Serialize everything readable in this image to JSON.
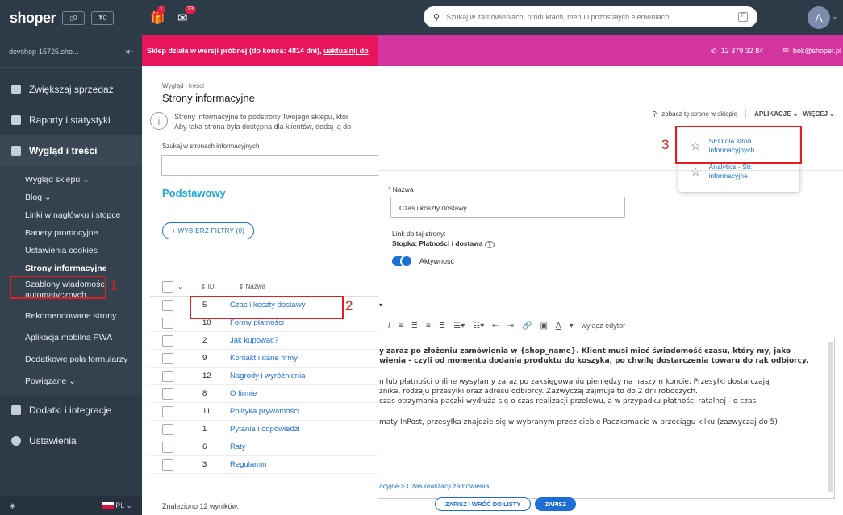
{
  "sidebar": {
    "logo": "shoper",
    "mini_a": "0",
    "mini_b": "0",
    "shop_name": "devshop-15725.sho...",
    "main_items": [
      "Zwiększaj sprzedaż",
      "Raporty i statystyki",
      "Wygląd i treści"
    ],
    "sub_items": [
      "Wygląd sklepu",
      "Blog",
      "Linki w nagłówku i stopce",
      "Banery promocyjne",
      "Ustawienia cookies",
      "Strony informacyjne",
      "Szablony wiadomości automatycznych",
      "Rekomendowane strony",
      "Aplikacja mobilna PWA",
      "Dodatkowe pola formularzy",
      "Powiązane"
    ],
    "extra_items": [
      "Dodatki i integracje",
      "Ustawienia"
    ],
    "lang": "PL"
  },
  "top": {
    "gift_badge": "1",
    "mail_badge": "23",
    "search_placeholder": "Szukaj w zamówieniach, produktach, menu i pozostałych elementach",
    "avatar_letter": "A"
  },
  "banner": {
    "text": "Sklep działa w wersji próbnej (do końca: 4814 dni),",
    "link": "uaktualnij do"
  },
  "contact": {
    "phone": "12 379 32 84",
    "email": "bok@shoper.pl"
  },
  "list_page": {
    "crumb": "Wygląd i treści",
    "title": "Strony informacyjne",
    "info_line1": "Strony informacyjne to podstrony Twojego sklepu, któr",
    "info_line2": "Aby taka strona była dostępna dla klientów, dodaj ją do",
    "search_label": "Szukaj w stronach informacyjnych",
    "section": "Podstawowy",
    "filter_button": "+ WYBIERZ FILTRY (0)",
    "col_id": "ID",
    "col_name": "Nazwa",
    "rows": [
      {
        "id": "5",
        "name": "Czas i koszty dostawy"
      },
      {
        "id": "10",
        "name": "Formy płatności"
      },
      {
        "id": "2",
        "name": "Jak kupować?"
      },
      {
        "id": "9",
        "name": "Kontakt i dane firmy"
      },
      {
        "id": "12",
        "name": "Nagrody i wyróżnienia"
      },
      {
        "id": "8",
        "name": "O firmie"
      },
      {
        "id": "11",
        "name": "Polityka prywatności"
      },
      {
        "id": "1",
        "name": "Pytania i odpowiedzi"
      },
      {
        "id": "6",
        "name": "Raty"
      },
      {
        "id": "3",
        "name": "Regulamin"
      }
    ],
    "found": "Znaleziono 12 wyników."
  },
  "edit_page": {
    "view_link": "zobacz tę stronę w sklepie",
    "apps": "APLIKACJE",
    "more": "WIĘCEJ",
    "dropdown": [
      "SEO dla stron informacyjnych",
      "Analytics - Str. informacyjne"
    ],
    "name_label": "Nazwa",
    "name_value": "Czas i koszty dostawy",
    "link_label": "Link do tej strony:",
    "link_value": "Stopka: Płatności i dostawa",
    "active_label": "Aktywność",
    "disable_editor": "wyłącz edytor",
    "editor_lines": [
      "y zaraz po złożeniu zamówienia w {shop_name}. Klient musi mieć świadomość czasu, który my, jako",
      "wienia - czyli od momentu dodania produktu do koszyka, po chwilę dostarczenia towaru do rąk odbiorcy.",
      "n lub płatności online wysyłamy zaraz po zaksięgowaniu pieniędzy na naszym koncie. Przesyłki dostarczają",
      "żnika, rodzaju przesyłki oraz adresu odbiorcy. Zazwyczaj zajmuje to do 2 dni roboczych.",
      " czas otrzymania paczki wydłuża się o czas realizacji przelewu, a w przypadku płatności ratalnej - o czas",
      "maty InPost, przesyłka znajdzie się w wybranym przez ciebie Paczkomacie w przeciągu kilku (zazwyczaj do 5)"
    ],
    "path": "acyjne > Czas realizacji zamówienia",
    "save_return": "ZAPISZ I WRÓĆ DO LISTY",
    "save": "ZAPISZ"
  },
  "annotations": [
    "1",
    "2",
    "3"
  ]
}
